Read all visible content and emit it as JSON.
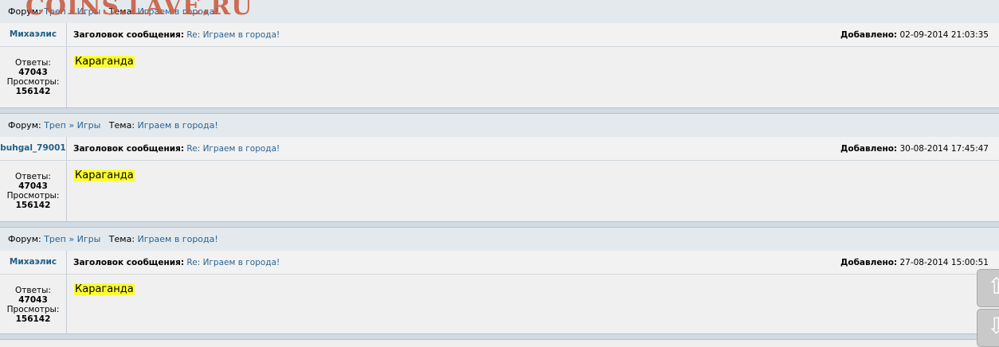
{
  "watermark": "COINS.LAVE.RU",
  "labels": {
    "forum": "Форум:",
    "sep": "»",
    "topic": "Тема:",
    "subject": "Заголовок сообщения:",
    "added": "Добавлено:",
    "replies": "Ответы:",
    "views": "Просмотры:"
  },
  "posts": [
    {
      "forum": "Треп",
      "subforum": "Игры",
      "topic": "Играем в города!",
      "author": "Михаэлис",
      "subject": "Re: Играем в города!",
      "date": "02-09-2014 21:03:35",
      "replies": "47043",
      "views": "156142",
      "message": "Караганда"
    },
    {
      "forum": "Треп",
      "subforum": "Игры",
      "topic": "Играем в города!",
      "author": "buhgal_79001",
      "subject": "Re: Играем в города!",
      "date": "30-08-2014 17:45:47",
      "replies": "47043",
      "views": "156142",
      "message": "Караганда"
    },
    {
      "forum": "Треп",
      "subforum": "Игры",
      "topic": "Играем в города!",
      "author": "Михаэлис",
      "subject": "Re: Играем в города!",
      "date": "27-08-2014 15:00:51",
      "replies": "47043",
      "views": "156142",
      "message": "Караганда"
    }
  ],
  "scroll": {
    "up_icon": "arrow-up-icon",
    "down_icon": "arrow-down-icon"
  }
}
